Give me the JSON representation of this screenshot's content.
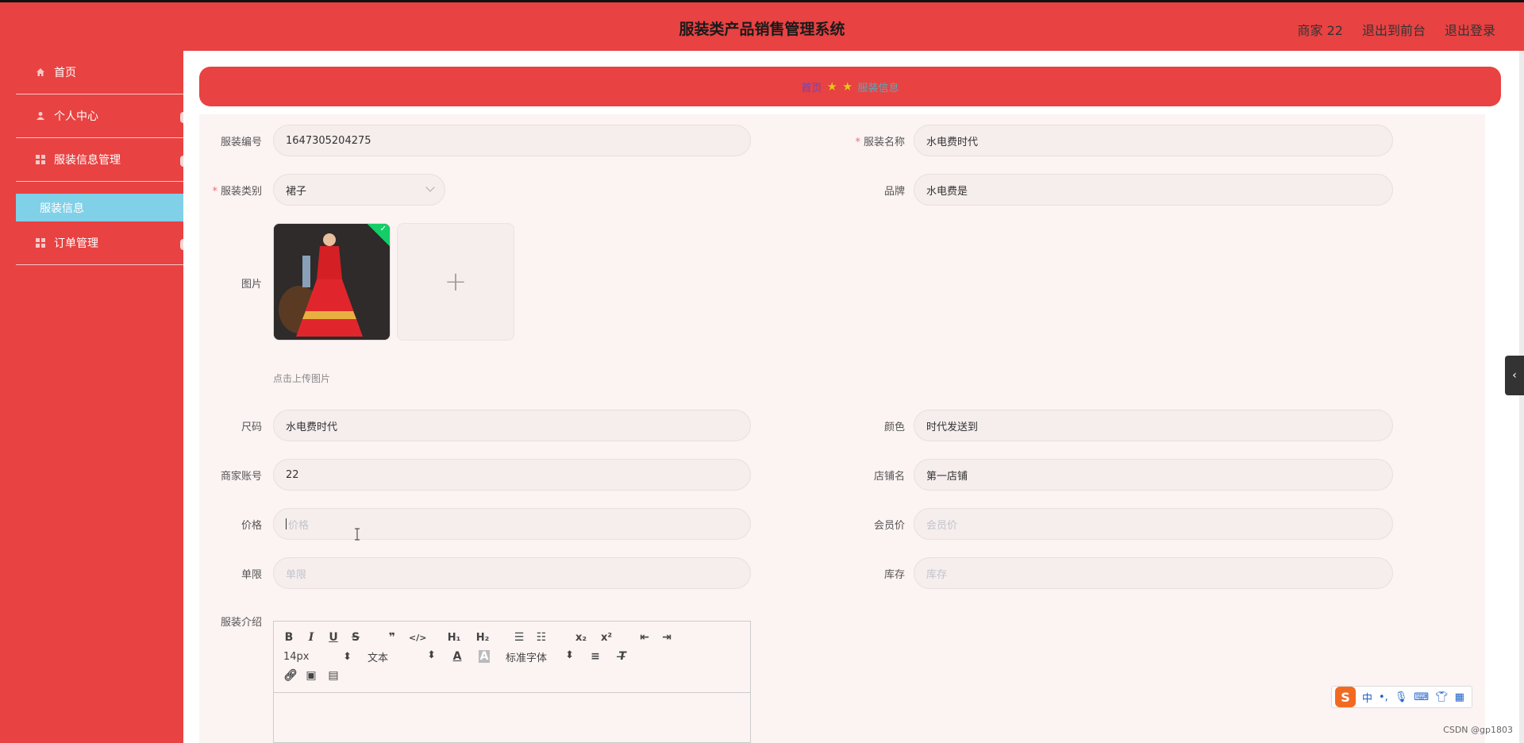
{
  "header": {
    "title": "服装类产品销售管理系统",
    "user": "商家 22",
    "exit_front": "退出到前台",
    "logout": "退出登录"
  },
  "sidebar": {
    "items": [
      {
        "label": "首页",
        "icon": "home-icon"
      },
      {
        "label": "个人中心",
        "icon": "user-icon"
      },
      {
        "label": "服装信息管理",
        "icon": "grid-icon"
      },
      {
        "label": "订单管理",
        "icon": "grid-icon"
      }
    ],
    "sub_active": "服装信息"
  },
  "breadcrumb": {
    "home": "首页",
    "current": "服装信息"
  },
  "form": {
    "code": {
      "label": "服装编号",
      "value": "1647305204275"
    },
    "name": {
      "label": "服装名称",
      "value": "水电费时代"
    },
    "category": {
      "label": "服装类别",
      "value": "裙子"
    },
    "brand": {
      "label": "品牌",
      "value": "水电费是"
    },
    "image": {
      "label": "图片",
      "hint": "点击上传图片",
      "add": "+"
    },
    "size": {
      "label": "尺码",
      "value": "水电费时代"
    },
    "color": {
      "label": "颜色",
      "value": "时代发送到"
    },
    "merchant": {
      "label": "商家账号",
      "value": "22"
    },
    "shop": {
      "label": "店铺名",
      "value": "第一店铺"
    },
    "price": {
      "label": "价格",
      "placeholder": "价格"
    },
    "member_price": {
      "label": "会员价",
      "placeholder": "会员价"
    },
    "limit": {
      "label": "单限",
      "placeholder": "单限"
    },
    "stock": {
      "label": "库存",
      "placeholder": "库存"
    },
    "intro": {
      "label": "服装介绍"
    }
  },
  "editor": {
    "font_size": "14px",
    "text_type": "文本",
    "font_family": "标准字体"
  },
  "ime": {
    "mode": "中"
  },
  "watermark": "CSDN @gp1803",
  "colors": {
    "primary": "#e84242",
    "active_sub": "#80d0e8",
    "required": "#f56c6c",
    "success": "#13ce66"
  }
}
